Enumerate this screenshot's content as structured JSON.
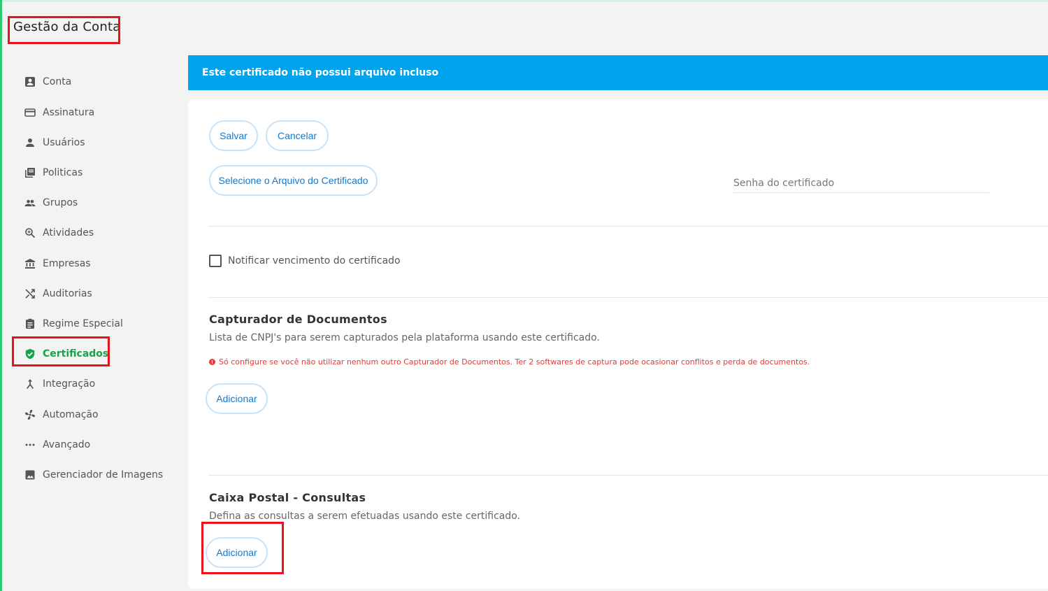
{
  "header": {
    "title": "Gestão da Conta"
  },
  "sidebar": {
    "items": [
      {
        "label": "Conta",
        "icon": "account-box-icon"
      },
      {
        "label": "Assinatura",
        "icon": "credit-card-icon"
      },
      {
        "label": "Usuários",
        "icon": "person-icon"
      },
      {
        "label": "Politicas",
        "icon": "library-books-icon"
      },
      {
        "label": "Grupos",
        "icon": "people-icon"
      },
      {
        "label": "Atividades",
        "icon": "search-zoom-icon"
      },
      {
        "label": "Empresas",
        "icon": "bank-icon"
      },
      {
        "label": "Auditorias",
        "icon": "shuffle-icon"
      },
      {
        "label": "Regime Especial",
        "icon": "clipboard-icon"
      },
      {
        "label": "Certificados",
        "icon": "shield-check-icon",
        "active": true
      },
      {
        "label": "Integração",
        "icon": "merge-icon"
      },
      {
        "label": "Automação",
        "icon": "fan-icon"
      },
      {
        "label": "Avançado",
        "icon": "more-horiz-icon"
      },
      {
        "label": "Gerenciador de Imagens",
        "icon": "image-icon"
      }
    ]
  },
  "banner": {
    "text": "Este certificado não possui arquivo incluso"
  },
  "form": {
    "save_label": "Salvar",
    "cancel_label": "Cancelar",
    "select_file_label": "Selecione o Arquivo do Certificado",
    "password_placeholder": "Senha do certificado",
    "notify_label": "Notificar vencimento do certificado",
    "notify_checked": false
  },
  "capturador": {
    "title": "Capturador de Documentos",
    "description": "Lista de CNPJ's para serem capturados pela plataforma usando este certificado.",
    "warning": "Só configure se você não utilizar nenhum outro Capturador de Documentos. Ter 2 softwares de captura pode ocasionar conflitos e perda de documentos.",
    "add_label": "Adicionar"
  },
  "caixa_postal": {
    "title": "Caixa Postal - Consultas",
    "description": "Defina as consultas a serem efetuadas usando este certificado.",
    "add_label": "Adicionar"
  },
  "colors": {
    "accent": "#00a3ec",
    "active": "#17a34a",
    "highlight": "#e8141b",
    "warning": "#e53935"
  }
}
